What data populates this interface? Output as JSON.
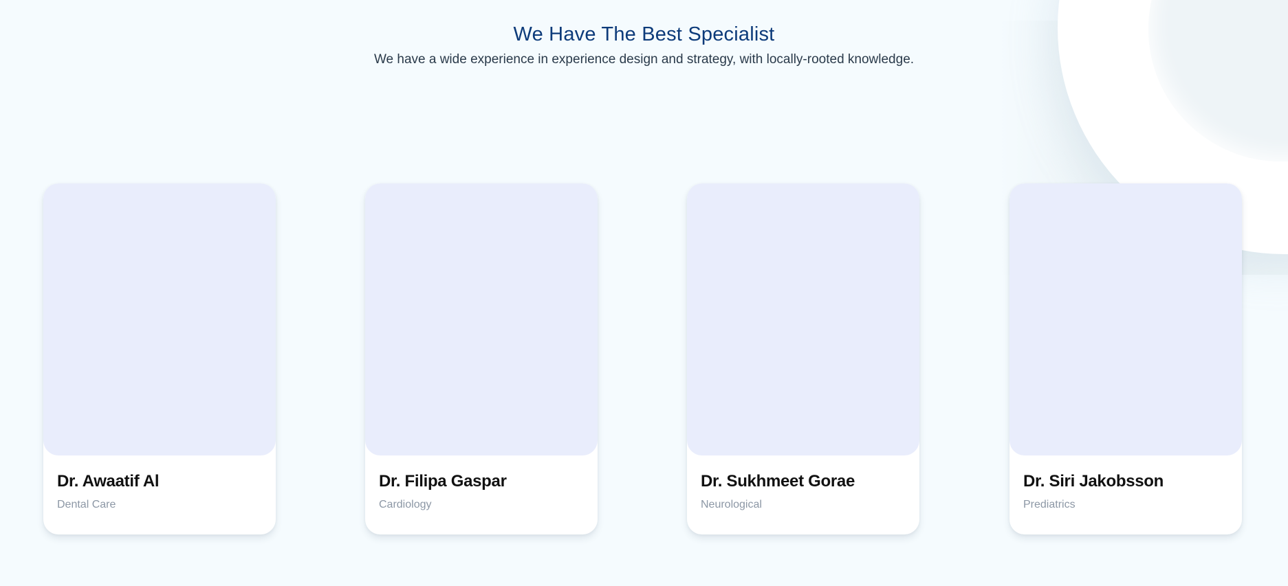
{
  "section": {
    "title": "We Have The Best Specialist",
    "subtitle": "We have a wide experience in experience design and strategy, with locally-rooted knowledge."
  },
  "doctors": [
    {
      "name": "Dr. Awaatif Al",
      "specialty": "Dental Care"
    },
    {
      "name": "Dr. Filipa Gaspar",
      "specialty": "Cardiology"
    },
    {
      "name": "Dr. Sukhmeet Gorae",
      "specialty": "Neurological"
    },
    {
      "name": "Dr. Siri Jakobsson",
      "specialty": "Prediatrics"
    }
  ],
  "colors": {
    "background": "#f5fbfe",
    "title": "#0d3b7a",
    "photo_placeholder": "#e9edfc",
    "specialty_text": "#8c97a5"
  }
}
